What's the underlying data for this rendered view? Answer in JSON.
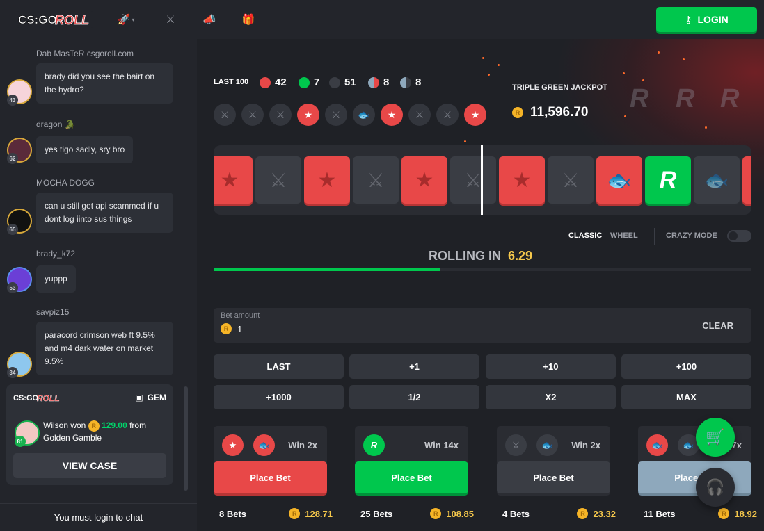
{
  "header": {
    "logo_text": "CS:GO ROLL",
    "nav_icons": [
      "rocket-icon",
      "swords-icon",
      "megaphone-icon",
      "gift-icon"
    ],
    "login_label": "LOGIN"
  },
  "chat": {
    "messages": [
      {
        "name": "Dab MasTeR csgoroll.com",
        "text": "brady did you see the bairt on the hydro?",
        "level": "43"
      },
      {
        "name": "dragon 🐊",
        "text": "yes tigo sadly, sry bro",
        "level": "62"
      },
      {
        "name": "MOCHA DOGG",
        "text": "can u still get api scammed if u dont log iinto sus things",
        "level": "65"
      },
      {
        "name": "brady_k72",
        "text": "yuppp",
        "level": "53"
      },
      {
        "name": "savpiz15",
        "text": "paracord crimson web ft 9.5% and m4 dark water on market 9.5%",
        "level": "34"
      }
    ],
    "promo": {
      "logo_text": "CS:GO ROLL",
      "gem_label": "GEM",
      "winner": "Wilson won",
      "amount": "129.00",
      "from_text": "from",
      "case_name": "Golden Gamble",
      "avatar_level": "81",
      "view_case_label": "VIEW CASE"
    },
    "login_prompt": "You must login to chat"
  },
  "stats": {
    "last100_label": "LAST 100",
    "red": "42",
    "green": "7",
    "black": "51",
    "red_bonus": "8",
    "black_bonus": "8",
    "history": [
      "grey",
      "grey",
      "grey",
      "red",
      "grey",
      "grey",
      "red",
      "grey",
      "grey",
      "red"
    ]
  },
  "jackpot": {
    "label": "TRIPLE GREEN JACKPOT",
    "value": "11,596.70"
  },
  "roller": {
    "tiles": [
      "red",
      "grey",
      "red",
      "grey",
      "red",
      "grey",
      "red",
      "grey",
      "red-fish",
      "green",
      "grey-fish",
      "red"
    ]
  },
  "modes": {
    "classic": "CLASSIC",
    "wheel": "WHEEL",
    "crazy": "CRAZY MODE"
  },
  "countdown": {
    "label": "ROLLING IN",
    "value": "6.29",
    "progress": 0.42
  },
  "bet": {
    "label": "Bet amount",
    "value": "1",
    "clear_label": "CLEAR",
    "quick_buttons": [
      "LAST",
      "+1",
      "+10",
      "+100",
      "+1000",
      "1/2",
      "X2",
      "MAX"
    ]
  },
  "cards": [
    {
      "win": "Win 2x",
      "place": "Place Bet",
      "bets": "8 Bets",
      "total": "128.71"
    },
    {
      "win": "Win 14x",
      "place": "Place Bet",
      "bets": "25 Bets",
      "total": "108.85"
    },
    {
      "win": "Win 2x",
      "place": "Place Bet",
      "bets": "4 Bets",
      "total": "23.32"
    },
    {
      "win": "Win 7x",
      "place": "Place Bet",
      "bets": "11 Bets",
      "total": "18.92"
    }
  ],
  "colors": {
    "accent_green": "#00c74d",
    "red": "#e84848",
    "gold": "#f5c84c"
  }
}
